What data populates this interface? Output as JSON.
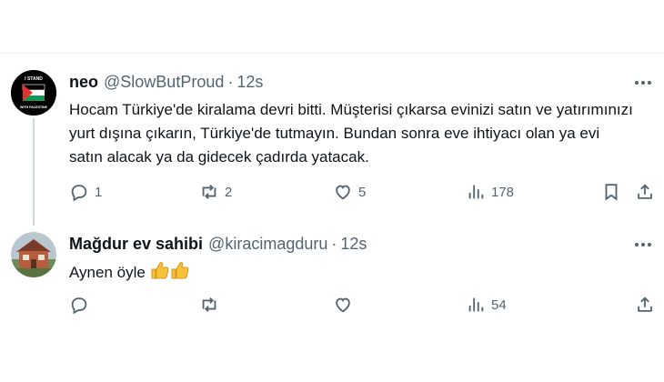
{
  "tweets": [
    {
      "display_name": "neo",
      "handle": "@SlowButProud",
      "time": "12s",
      "text": "Hocam Türkiye'de kiralama devri bitti. Müşterisi çıkarsa evinizi satın ve yatırımınızı yurt dışına çıkarın, Türkiye'de tutmayın. Bundan sonra eve ihtiyacı olan ya evi satın alacak ya da gidecek çadırda yatacak.",
      "avatar_text": "I STAND WITH PALESTINE",
      "replies": "1",
      "reposts": "2",
      "likes": "5",
      "views": "178"
    },
    {
      "display_name": "Mağdur ev sahibi",
      "handle": "@kiracimagduru",
      "time": "12s",
      "text": "Aynen öyle",
      "replies": "",
      "reposts": "",
      "likes": "",
      "views": "54"
    }
  ],
  "separator": "·",
  "icons": {
    "reply": "reply-icon",
    "repost": "repost-icon",
    "like": "heart-icon",
    "views": "views-icon",
    "bookmark": "bookmark-icon",
    "share": "share-icon",
    "more": "more-icon",
    "emoji": "thumbs-up-icon"
  },
  "colors": {
    "text": "#0f1419",
    "muted": "#536471",
    "divider": "#eff3f4",
    "thread_line": "#cfd9de",
    "palestine_red": "#e4312b",
    "palestine_green": "#149954"
  }
}
